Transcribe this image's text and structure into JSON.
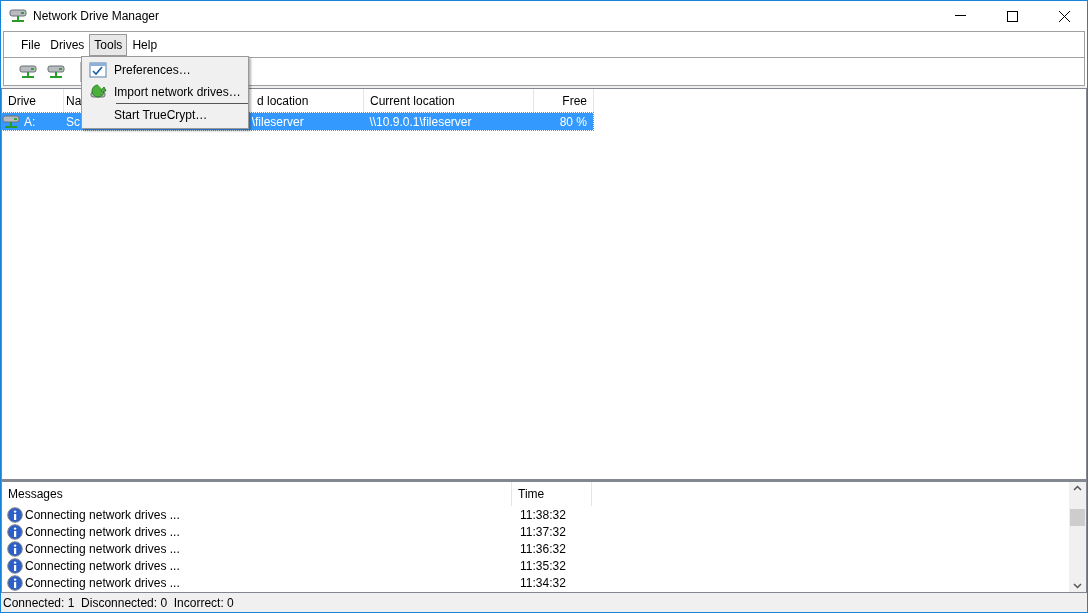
{
  "window": {
    "title": "Network Drive Manager"
  },
  "menu_bar": [
    {
      "label": "File",
      "selected": false
    },
    {
      "label": "Drives",
      "selected": false
    },
    {
      "label": "Tools",
      "selected": true
    },
    {
      "label": "Help",
      "selected": false
    }
  ],
  "dropdown": [
    {
      "label": "Preferences…"
    },
    {
      "label": "Import network drives…"
    },
    {
      "label": "Start TrueCrypt…"
    }
  ],
  "drives_table": {
    "columns": [
      "Drive",
      "Na",
      "d location",
      "Current location",
      "Free"
    ],
    "rows": [
      {
        "drive": "A:",
        "column_2": "Sc",
        "column_3": "\\fileserver",
        "current_location": "\\\\10.9.0.1\\fileserver",
        "free": "80 %",
        "selected": true
      }
    ]
  },
  "messages": {
    "columns": [
      "Messages",
      "Time"
    ],
    "rows": [
      {
        "text": "Connecting network drives ...",
        "time": "11:38:32"
      },
      {
        "text": "Connecting network drives ...",
        "time": "11:37:32"
      },
      {
        "text": "Connecting network drives ...",
        "time": "11:36:32"
      },
      {
        "text": "Connecting network drives ...",
        "time": "11:35:32"
      },
      {
        "text": "Connecting network drives ...",
        "time": "11:34:32"
      }
    ]
  },
  "status_bar": "Connected: 1  Disconnected: 0  Incorrect: 0"
}
